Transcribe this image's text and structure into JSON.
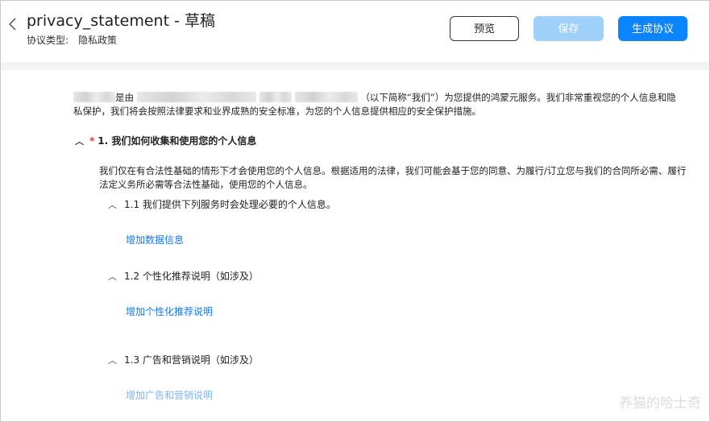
{
  "header": {
    "title": "privacy_statement - 草稿",
    "agreement_type_label": "协议类型:",
    "agreement_type_value": "隐私政策",
    "back_icon": "chevron-left-icon",
    "preview_label": "预览",
    "save_label": "保存",
    "generate_label": "生成协议",
    "colors": {
      "primary": "#0a84ff",
      "disabled": "#9ed0fa"
    }
  },
  "intro": {
    "text_1": "是由",
    "text_2": "（以下简称“我们”）为您提供的鸿蒙元服务。我们非常重视您的个人信息和隐私保护，我们将会按照法律要求和业界成熟的安全标准，为您的个人信息提供相应的安全保护措施。"
  },
  "section1": {
    "required_mark": "*",
    "title": "1. 我们如何收集和使用您的个人信息",
    "paragraph": "我们仅在有合法性基础的情形下才会使用您的个人信息。根据适用的法律，我们可能会基于您的同意、为履行/订立您与我们的合同所必需、履行法定义务所必需等合法性基础，使用您的个人信息。",
    "subsections": [
      {
        "title": "1.1 我们提供下列服务时会处理必要的个人信息。",
        "action": "增加数据信息"
      },
      {
        "title": "1.2 个性化推荐说明（如涉及）",
        "action": "增加个性化推荐说明"
      },
      {
        "title": "1.3 广告和营销说明（如涉及）",
        "action": "增加广告和营销说明"
      }
    ]
  },
  "watermark": "养猫的哈士奇"
}
